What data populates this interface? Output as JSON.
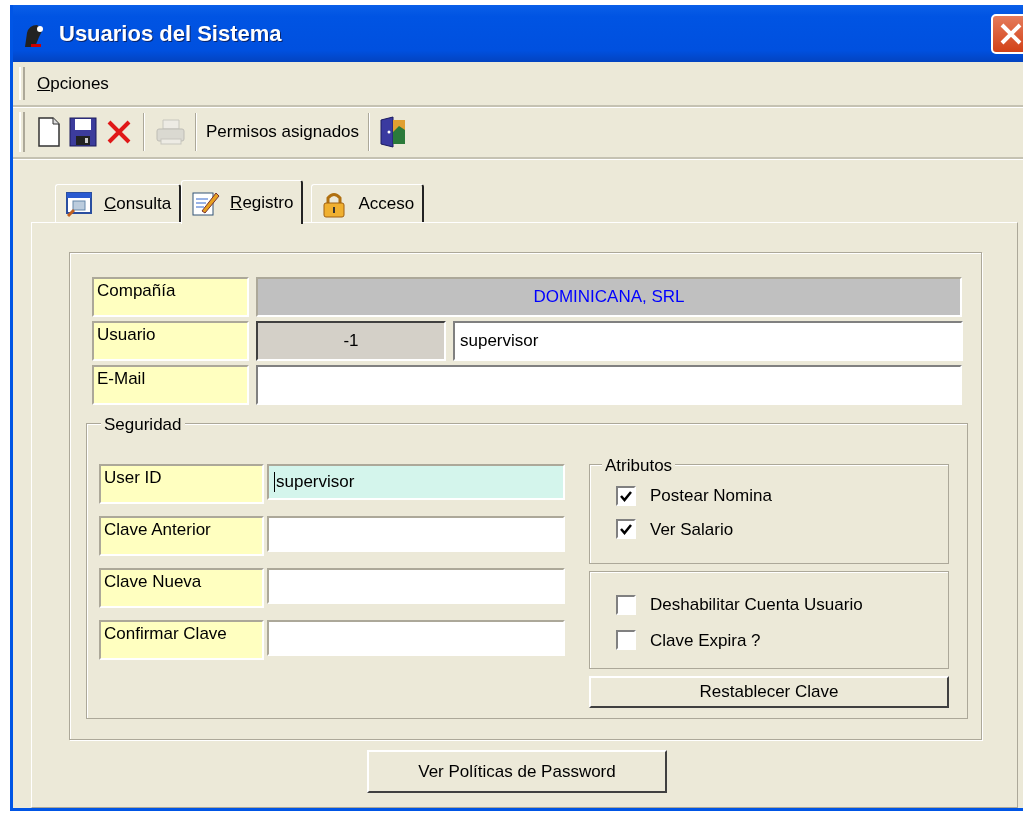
{
  "window": {
    "title": "Usuarios del Sistema"
  },
  "menu": [
    {
      "label": "Opciones",
      "mnemonic": true
    }
  ],
  "toolbar": [
    {
      "kind": "icon",
      "disabled": false
    },
    {
      "kind": "icon",
      "disabled": false
    },
    {
      "kind": "icon",
      "disabled": false
    },
    {
      "kind": "separator"
    },
    {
      "kind": "icon",
      "disabled": true
    },
    {
      "kind": "separator"
    },
    {
      "kind": "text",
      "label": "Permisos asignados"
    },
    {
      "kind": "separator"
    },
    {
      "kind": "icon",
      "disabled": false
    }
  ],
  "tabs": [
    {
      "label": "Consulta",
      "selected": false,
      "mnemonic": true
    },
    {
      "label": "Registro",
      "selected": true,
      "mnemonic": true
    },
    {
      "label": "Acceso",
      "selected": false,
      "mnemonic": false
    }
  ],
  "company": {
    "label": "Compañía",
    "value": "DOMINICANA, SRL"
  },
  "user": {
    "label": "Usuario",
    "id": "-1",
    "name": "supervisor"
  },
  "email": {
    "label": "E-Mail"
  },
  "security": {
    "title": "Seguridad",
    "fields": [
      {
        "label": "User ID",
        "value": "supervisor",
        "focused": true
      },
      {
        "label": "Clave Anterior",
        "focused": false
      },
      {
        "label": "Clave Nueva",
        "focused": false
      },
      {
        "label": "Confirmar Clave",
        "focused": false
      }
    ],
    "attributes": {
      "title": "Atributos",
      "options": [
        {
          "label": "Postear Nomina",
          "checked": true
        },
        {
          "label": "Ver Salario",
          "checked": true
        }
      ]
    },
    "account_options": [
      {
        "label": "Deshabilitar Cuenta Usuario",
        "checked": false
      },
      {
        "label": "Clave Expira ?",
        "checked": false
      }
    ],
    "reset_button": "Restablecer Clave"
  },
  "policy_button": "Ver Políticas de Password"
}
